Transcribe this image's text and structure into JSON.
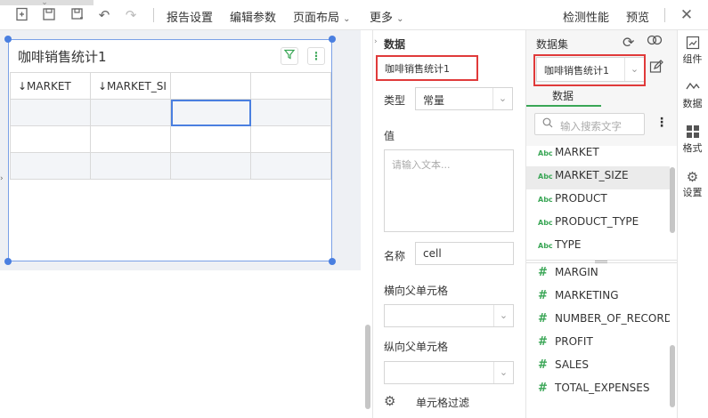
{
  "toolbar": {
    "report_settings": "报告设置",
    "edit_params": "编辑参数",
    "page_layout": "页面布局",
    "more": "更多",
    "check_perf": "检测性能",
    "preview": "预览"
  },
  "report": {
    "title": "咖啡销售统计1",
    "columns": [
      "↓MARKET",
      "↓MARKET_SI",
      "",
      ""
    ]
  },
  "props": {
    "header": "数据",
    "dataset_name": "咖啡销售统计1",
    "type_label": "类型",
    "type_value": "常量",
    "value_label": "值",
    "value_placeholder": "请输入文本...",
    "name_label": "名称",
    "name_value": "cell",
    "h_parent_label": "横向父单元格",
    "v_parent_label": "纵向父单元格",
    "cell_filter": "单元格过滤"
  },
  "dataset": {
    "label": "数据集",
    "selected": "咖啡销售统计1",
    "tab": "数据",
    "search_placeholder": "输入搜索文字",
    "dimensions": [
      "MARKET",
      "MARKET_SIZE",
      "PRODUCT",
      "PRODUCT_TYPE",
      "TYPE"
    ],
    "measures": [
      "MARGIN",
      "MARKETING",
      "NUMBER_OF_RECORD",
      "PROFIT",
      "SALES",
      "TOTAL_EXPENSES"
    ],
    "abc_tag": "Abc",
    "num_tag": "#"
  },
  "rail": {
    "components": "组件",
    "data": "数据",
    "format": "格式",
    "settings": "设置"
  },
  "colors": {
    "accent": "#4a7fe0",
    "highlight": "#e03a3a",
    "field_icon": "#3aa656"
  }
}
